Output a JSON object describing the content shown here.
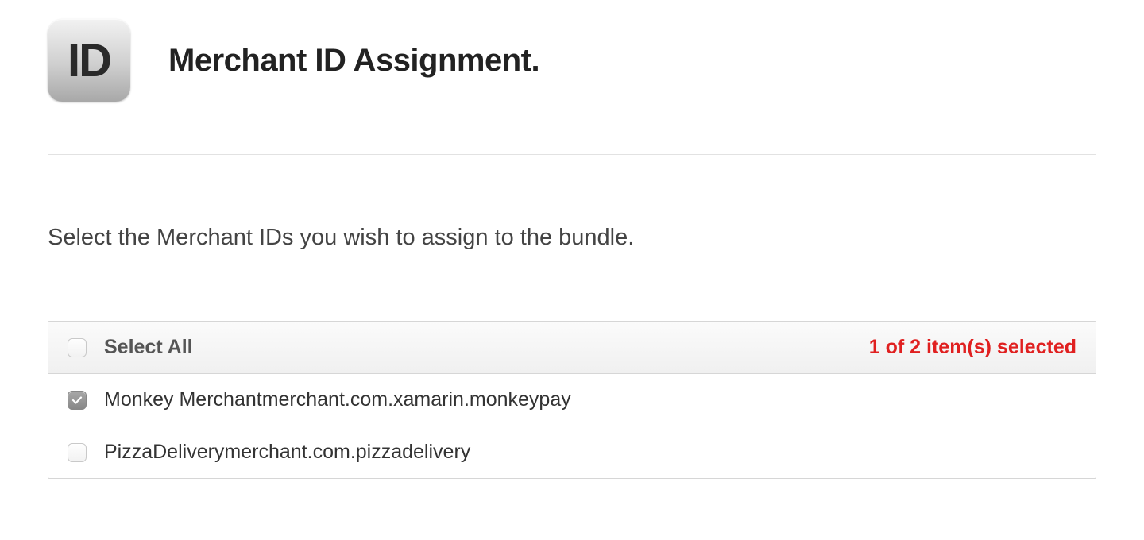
{
  "header": {
    "badge_text": "ID",
    "title": "Merchant ID Assignment."
  },
  "instruction": "Select the Merchant IDs you wish to assign to the bundle.",
  "table": {
    "select_all_label": "Select All",
    "selected_count_text": "1 of 2 item(s) selected",
    "select_all_checked": false,
    "rows": [
      {
        "label": "Monkey Merchantmerchant.com.xamarin.monkeypay",
        "checked": true
      },
      {
        "label": "PizzaDeliverymerchant.com.pizzadelivery",
        "checked": false
      }
    ]
  }
}
